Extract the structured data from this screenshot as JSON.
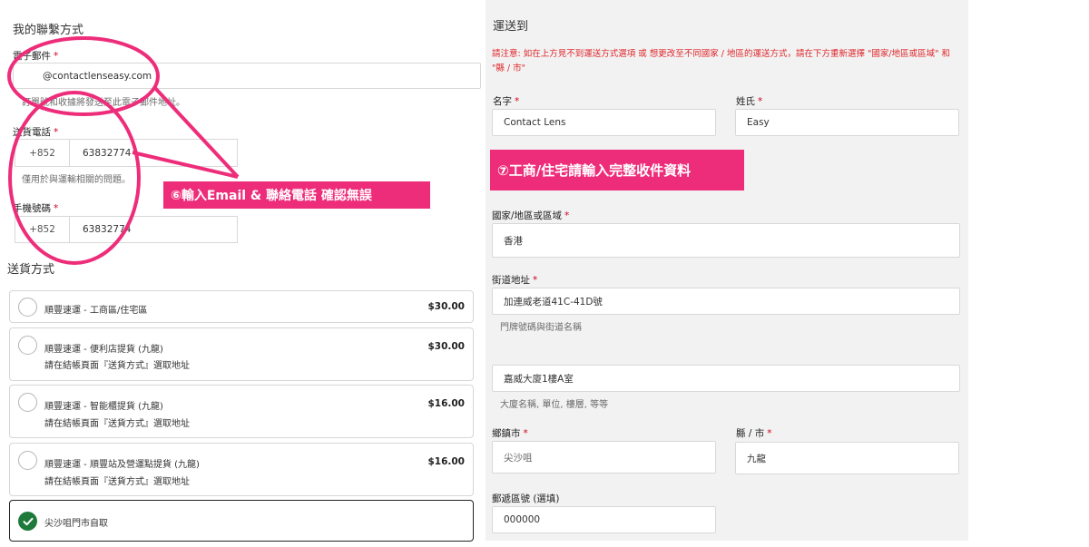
{
  "contact": {
    "section_title": "我的聯繫方式",
    "email_label": "電子郵件",
    "required_mark": "*",
    "email_value": "@contactlenseasy.com",
    "email_hint": "訂單號和收據將發送至此電子郵件地址。",
    "delivery_phone_label": "送貨電話",
    "delivery_phone_code": "+852",
    "delivery_phone_number": "63832774",
    "delivery_phone_hint": "僅用於與運輸相關的問題。",
    "mobile_label": "手機號碼",
    "mobile_code": "+852",
    "mobile_number": "63832774"
  },
  "shipping": {
    "section_title": "送貨方式",
    "options": [
      {
        "name": "順豐速運 - 工商區/住宅區",
        "sub": "",
        "price": "$30.00"
      },
      {
        "name": "順豐速運 - 便利店提貨 (九龍)",
        "sub": "請在結帳頁面『送貨方式』選取地址",
        "price": "$30.00"
      },
      {
        "name": "順豐速運 - 智能櫃提貨 (九龍)",
        "sub": "請在結帳頁面『送貨方式』選取地址",
        "price": "$16.00"
      },
      {
        "name": "順豐速運 - 順豐站及營運點提貨 (九龍)",
        "sub": "請在結帳頁面『送貨方式』選取地址",
        "price": "$16.00"
      },
      {
        "name": "尖沙咀門市自取",
        "sub": "",
        "price": ""
      }
    ],
    "selected_index": 4
  },
  "address": {
    "section_title": "運送到",
    "warning": "請注意: 如在上方見不到運送方式選項 或 想更改至不同國家 / 地區的運送方式，請在下方重新選擇 \"國家/地區或區域\" 和 \"縣 / 市\"",
    "first_name_label": "名字",
    "first_name_value": "Contact Lens",
    "last_name_label": "姓氏",
    "last_name_value": "Easy",
    "country_label": "國家/地區或區域",
    "country_value": "香港",
    "street_label": "街道地址",
    "street_value": "加連威老道41C-41D號",
    "street_hint": "門牌號碼與街道名稱",
    "street2_value": "嘉威大廈1樓A室",
    "street2_hint": "大廈名稱, 單位, 樓層, 等等",
    "town_label": "鄉鎮市",
    "town_value": "尖沙咀",
    "county_label": "縣 / 市",
    "county_value": "九龍",
    "postcode_label": "郵遞區號 (選填)",
    "postcode_value": "000000"
  },
  "annotations": {
    "contact_note": "⑥輸入Email & 聯絡電話 確認無誤",
    "address_note": "⑦工商/住宅請輸入完整收件資料"
  },
  "colors": {
    "annotation_pink": "#ee2d7a",
    "warning_red": "#e0262b",
    "check_green": "#1e7a3b",
    "panel_gray": "#f2f2f2"
  }
}
